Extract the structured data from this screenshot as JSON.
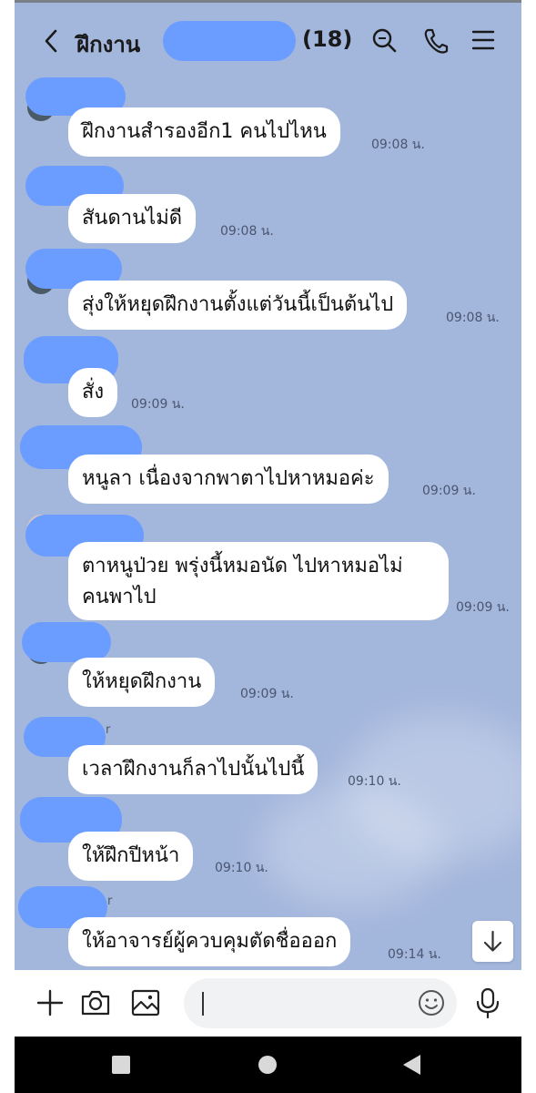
{
  "header": {
    "group_name": "ฝึกงาน",
    "member_count": "(18)",
    "icons": [
      "back-icon",
      "search-icon",
      "call-icon",
      "menu-icon"
    ]
  },
  "messages": [
    {
      "text": "ฝึกงานสำรองอีก1 คนไปไหน",
      "time": "09:08 น."
    },
    {
      "text": "สันดานไม่ดี",
      "time": "09:08 น."
    },
    {
      "text": "สุ่งให้หยุดฝึกงานตั้งแต่วันนี้เป็นต้นไป",
      "time": "09:08 น."
    },
    {
      "text": "สั่ง",
      "time": "09:09 น."
    },
    {
      "text": "หนูลา เนื่องจากพาตาไปหาหมอค่ะ",
      "time": "09:09 น."
    },
    {
      "text": "ตาหนูป่วย พรุ่งนี้หมอนัด ไปหาหมอไม่\nคนพาไป",
      "time": "09:09 น."
    },
    {
      "text": "ให้หยุดฝึกงาน",
      "time": "09:09 น."
    },
    {
      "text": "เวลาฝึกงานก็ลาไปนั้นไปนี้",
      "time": "09:10 น."
    },
    {
      "text": "ให้ฝึกปีหน้า",
      "time": "09:10 น."
    },
    {
      "text": "ให้อาจารย์ผู้ควบคุมตัดชื่อออก",
      "time": "09:14 น."
    }
  ],
  "sender_fragments": [
    "r",
    "r"
  ],
  "input": {
    "placeholder": ""
  },
  "colors": {
    "chat_bg": "#a3b6dc",
    "redaction": "#6b9cff",
    "bubble": "#ffffff"
  }
}
